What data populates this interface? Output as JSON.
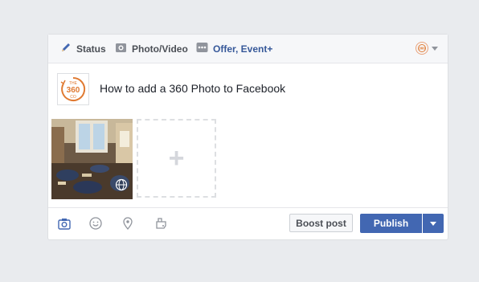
{
  "tabs": [
    {
      "label": "Status",
      "icon": "pencil-icon"
    },
    {
      "label": "Photo/Video",
      "icon": "camera-icon"
    },
    {
      "label": "Offer, Event+",
      "icon": "more-icon"
    }
  ],
  "audience": {
    "icon": "the360co-logo-icon"
  },
  "post": {
    "avatar_logo": {
      "line1": "THE",
      "line2": "360",
      "line3": "CO"
    },
    "text": "How to add a 360 Photo to Facebook"
  },
  "media": {
    "photo": {
      "badge_icon": "globe-360-icon"
    },
    "add_tile": {
      "symbol": "+"
    }
  },
  "footer": {
    "icons": [
      "camera-icon",
      "smiley-icon",
      "location-pin-icon",
      "tag-icon"
    ],
    "boost_label": "Boost post",
    "publish_label": "Publish"
  },
  "colors": {
    "accent": "#4267b2",
    "brand_orange": "#e07a32",
    "background": "#e9ebee"
  }
}
